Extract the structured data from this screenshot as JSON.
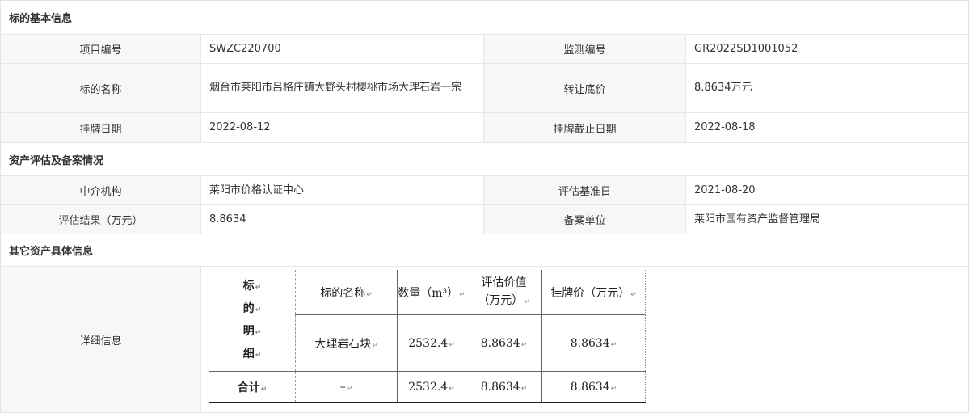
{
  "sections": {
    "basic": "标的基本信息",
    "assessment": "资产评估及备案情况",
    "other": "其它资产具体信息"
  },
  "basic": {
    "project_no_label": "项目编号",
    "project_no": "SWZC220700",
    "monitor_no_label": "监测编号",
    "monitor_no": "GR2022SD1001052",
    "name_label": "标的名称",
    "name": "烟台市莱阳市吕格庄镇大野头村樱桃市场大理石岩一宗",
    "reserve_price_label": "转让底价",
    "reserve_price": "8.8634万元",
    "list_date_label": "挂牌日期",
    "list_date": "2022-08-12",
    "list_end_label": "挂牌截止日期",
    "list_end": "2022-08-18"
  },
  "assessment": {
    "agency_label": "中介机构",
    "agency": "莱阳市价格认证中心",
    "base_date_label": "评估基准日",
    "base_date": "2021-08-20",
    "result_label": "评估结果（万元）",
    "result": "8.8634",
    "filing_unit_label": "备案单位",
    "filing_unit": "莱阳市国有资产监督管理局"
  },
  "other": {
    "detail_label": "详细信息",
    "table": {
      "row_header_chars": [
        "标",
        "的",
        "明",
        "细"
      ],
      "col_name": "标的名称",
      "col_qty": "数量（m³）",
      "col_eval_1": "评估价值",
      "col_eval_2": "（万元）",
      "col_list": "挂牌价（万元）",
      "item_name": "大理岩石块",
      "item_qty": "2532.4",
      "item_eval": "8.8634",
      "item_list": "8.8634",
      "total_label": "合计",
      "total_name": "–",
      "total_qty": "2532.4",
      "total_eval": "8.8634",
      "total_list": "8.8634",
      "para_mark": "↵"
    }
  }
}
